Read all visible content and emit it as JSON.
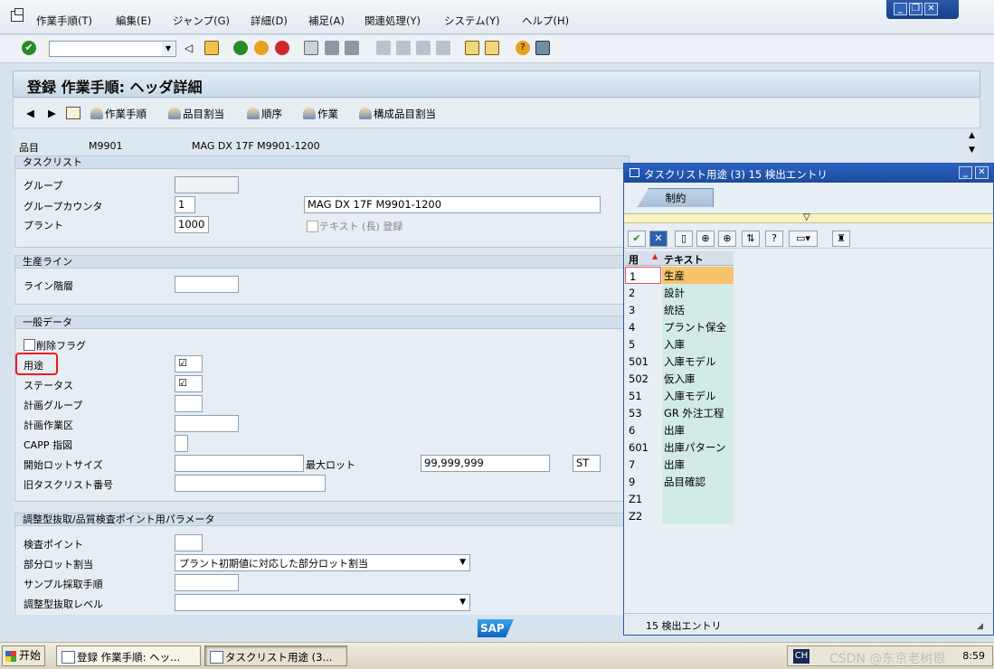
{
  "menu": [
    "作業手順(T)",
    "編集(E)",
    "ジャンプ(G)",
    "詳細(D)",
    "補足(A)",
    "関連処理(Y)",
    "システム(Y)",
    "ヘルプ(H)"
  ],
  "title": "登録 作業手順: ヘッダ詳細",
  "app_toolbar": [
    "作業手順",
    "品目割当",
    "順序",
    "作業",
    "構成品目割当"
  ],
  "header": {
    "material_label": "品目",
    "material": "M9901",
    "material_text": "MAG DX 17F M9901-1200"
  },
  "groups": {
    "tasklist": {
      "title": "タスクリスト",
      "group_label": "グループ",
      "group_value": "",
      "counter_label": "グループカウンタ",
      "counter_value": "1",
      "description": "MAG DX 17F M9901-1200",
      "plant_label": "プラント",
      "plant_value": "1000",
      "longtext_label": "テキスト (長) 登録"
    },
    "production_line": {
      "title": "生産ライン",
      "line_level_label": "ライン階層"
    },
    "general": {
      "title": "一般データ",
      "delete_flag": "削除フラグ",
      "usage": "用途",
      "usage_value": "☑",
      "status": "ステータス",
      "status_value": "☑",
      "planner_group": "計画グループ",
      "planning_work_center": "計画作業区",
      "capp": "CAPP 指図",
      "from_lot": "開始ロットサイズ",
      "to_lot_label": "最大ロット",
      "to_lot_value": "99,999,999",
      "unit": "ST",
      "old_tasklist": "旧タスクリスト番号"
    },
    "qm": {
      "title": "調整型抜取/品質検査ポイント用パラメータ",
      "insp_points": "検査ポイント",
      "partial_lot": "部分ロット割当",
      "partial_lot_value": "プラント初期値に対応した部分ロット割当",
      "sample_proc": "サンプル採取手順",
      "dyn_level": "調整型抜取レベル"
    }
  },
  "popup": {
    "title": "タスクリスト用途 (3)   15 検出エントリ",
    "tab": "制約",
    "col_usage": "用",
    "col_text": "テキスト",
    "rows": [
      {
        "code": "1",
        "text": "生産"
      },
      {
        "code": "2",
        "text": "設計"
      },
      {
        "code": "3",
        "text": "統括"
      },
      {
        "code": "4",
        "text": "プラント保全"
      },
      {
        "code": "5",
        "text": "入庫"
      },
      {
        "code": "501",
        "text": "入庫モデル"
      },
      {
        "code": "502",
        "text": "仮入庫"
      },
      {
        "code": "51",
        "text": "入庫モデル"
      },
      {
        "code": "53",
        "text": "GR 外注工程"
      },
      {
        "code": "6",
        "text": "出庫"
      },
      {
        "code": "601",
        "text": "出庫パターン"
      },
      {
        "code": "7",
        "text": "出庫"
      },
      {
        "code": "9",
        "text": "品目確認"
      },
      {
        "code": "Z1",
        "text": ""
      },
      {
        "code": "Z2",
        "text": ""
      }
    ],
    "status": "15 検出エントリ"
  },
  "taskbar": {
    "start": "开始",
    "task1": "登録 作業手順: ヘッ...",
    "task2": "タスクリスト用途 (3...",
    "ime": "CH",
    "watermark": "CSDN @东京老树根",
    "time": "8:59"
  },
  "sap_logo": "SAP",
  "colors": {
    "accent": "#1d4a9c",
    "selected_row": "#f7c46b",
    "highlight_box": "#ee1b1b"
  }
}
